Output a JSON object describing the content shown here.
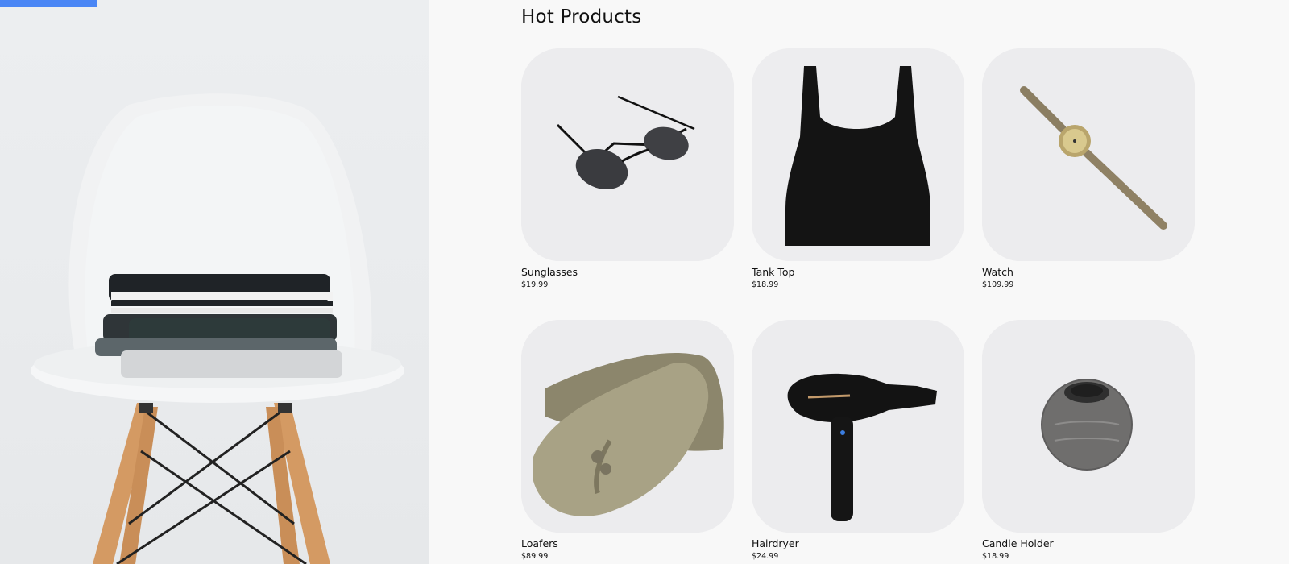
{
  "hero": {
    "accent_color": "#4a86f5",
    "image": "white-chair-with-folded-clothes"
  },
  "section": {
    "title": "Hot Products"
  },
  "products": [
    {
      "name": "Sunglasses",
      "price": "$19.99",
      "icon": "sunglasses-image"
    },
    {
      "name": "Tank Top",
      "price": "$18.99",
      "icon": "tank-top-image"
    },
    {
      "name": "Watch",
      "price": "$109.99",
      "icon": "watch-image"
    },
    {
      "name": "Loafers",
      "price": "$89.99",
      "icon": "loafers-image"
    },
    {
      "name": "Hairdryer",
      "price": "$24.99",
      "icon": "hairdryer-image"
    },
    {
      "name": "Candle Holder",
      "price": "$18.99",
      "icon": "candle-holder-image"
    }
  ]
}
